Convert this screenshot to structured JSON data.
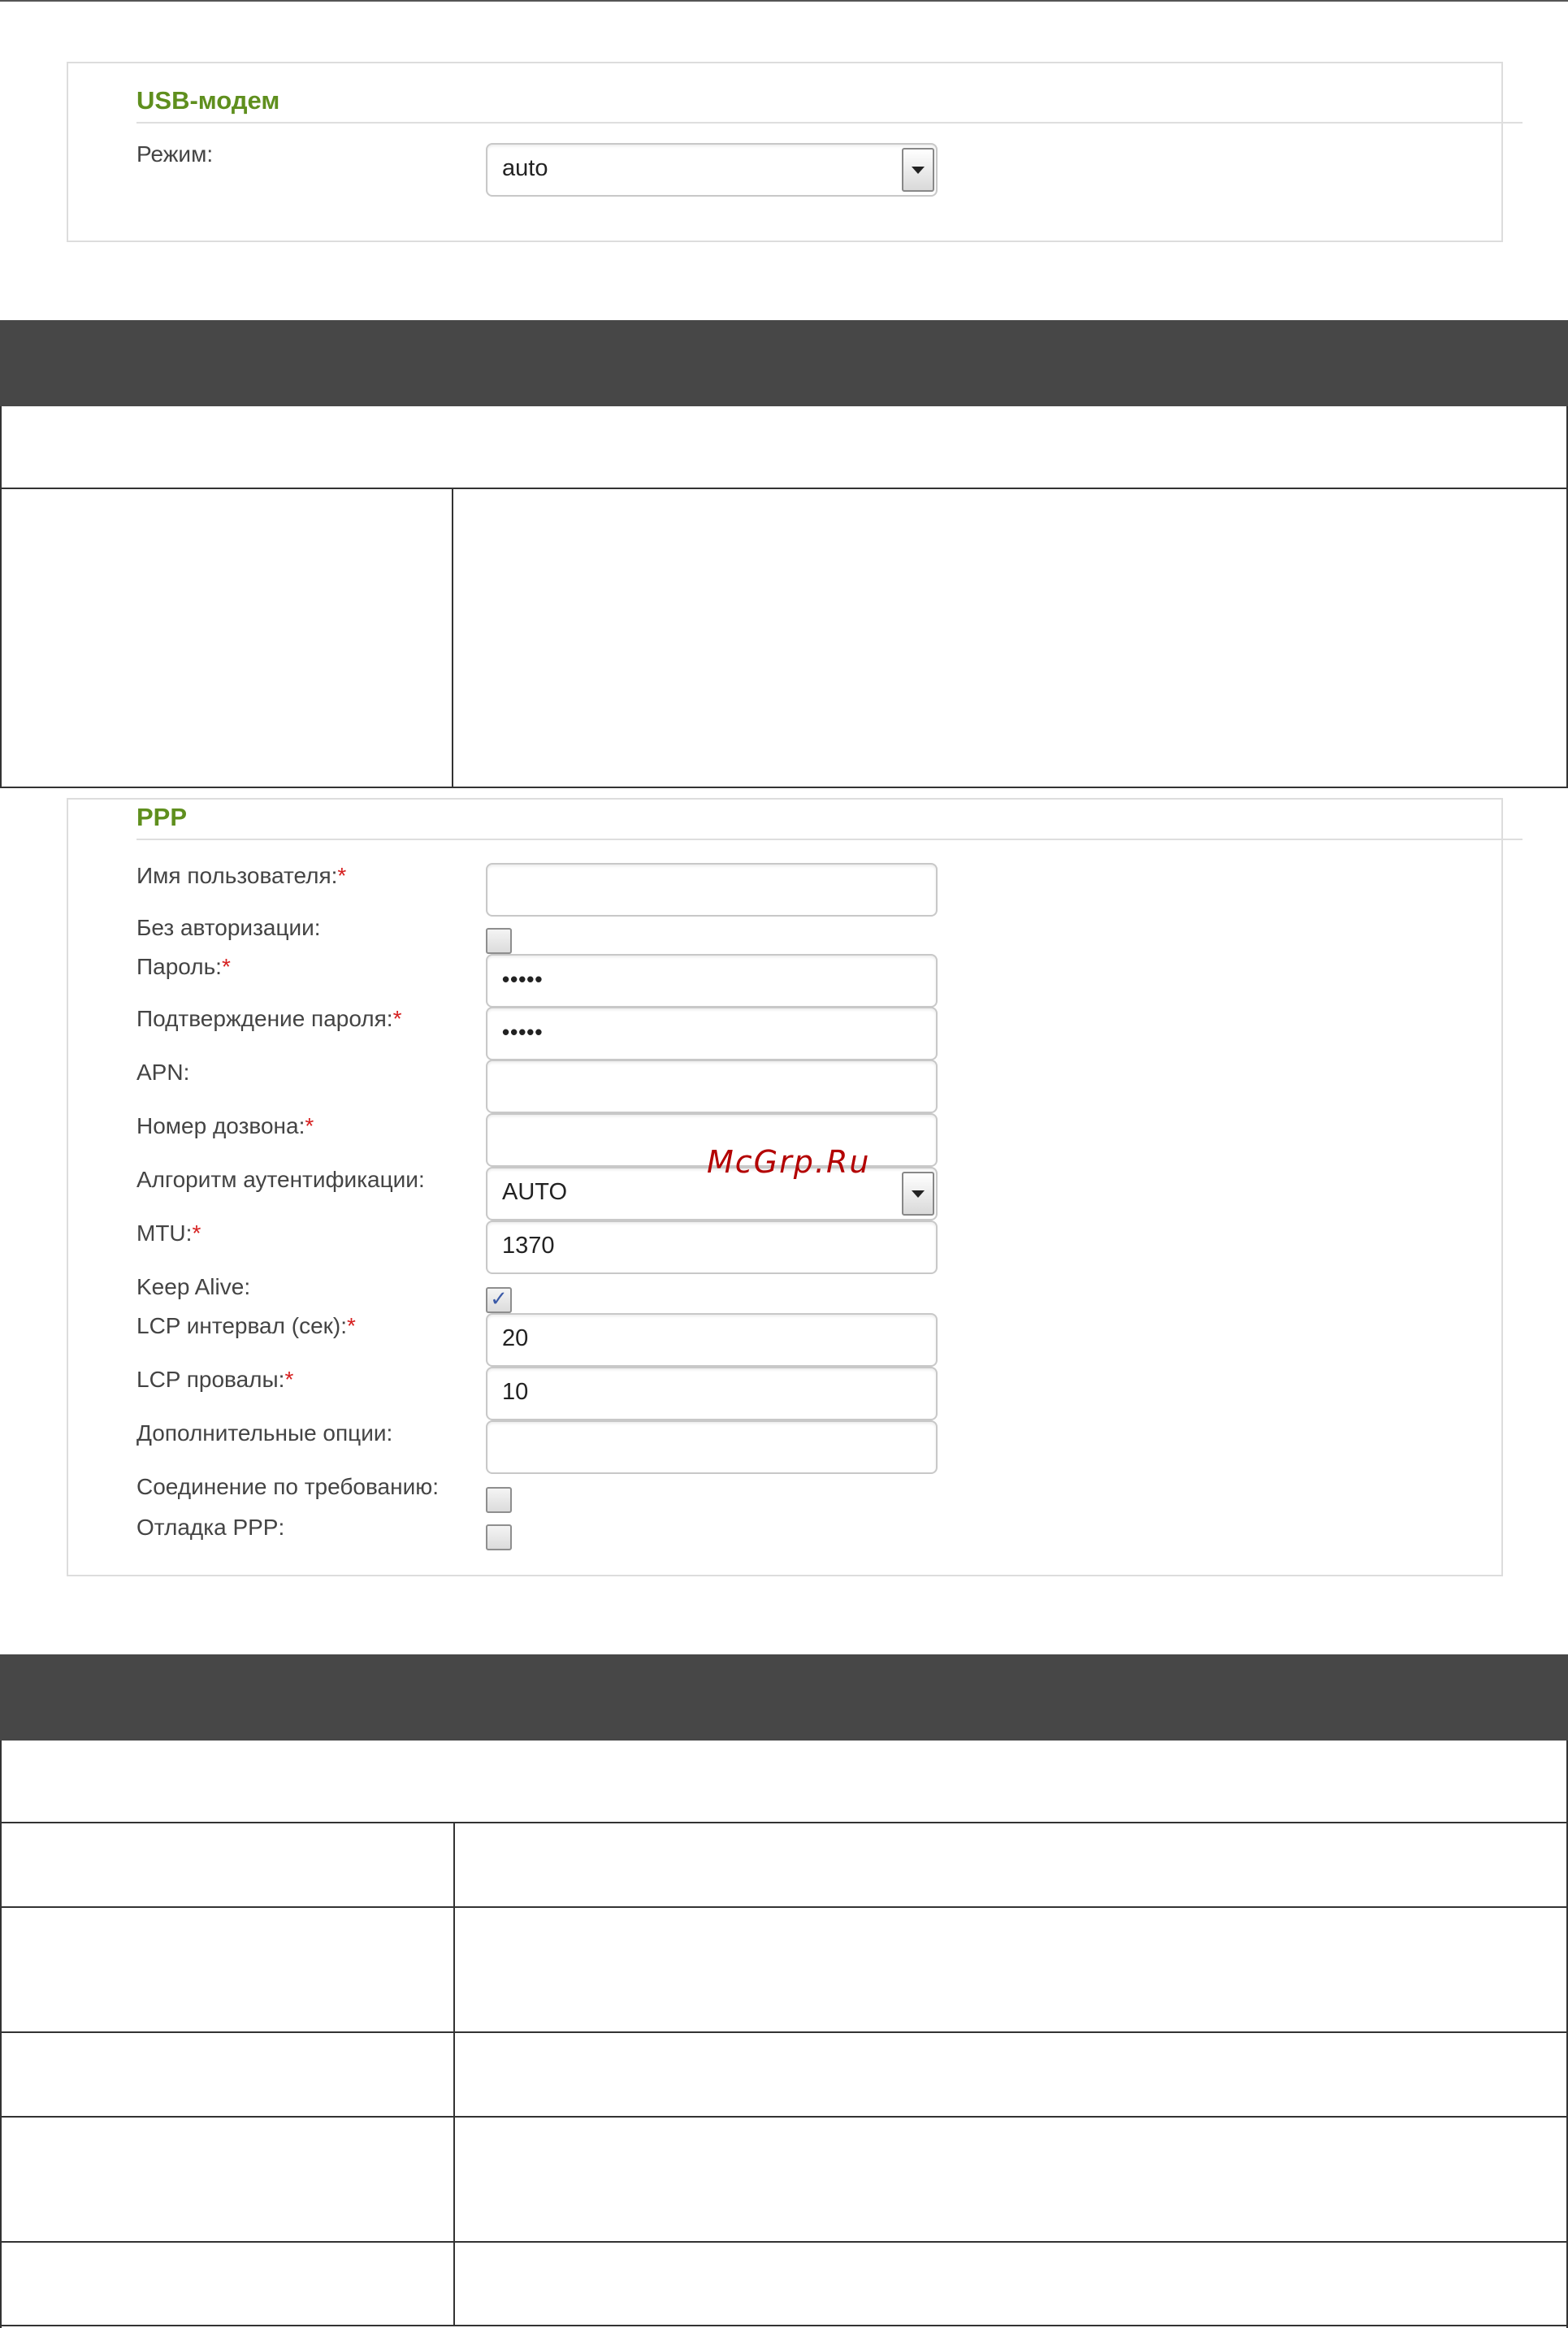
{
  "usb_panel": {
    "title": "USB-модем",
    "mode_label": "Режим:",
    "mode_value": "auto"
  },
  "ppp_panel": {
    "title": "PPP",
    "required_mark": "*",
    "fields": {
      "username": {
        "label": "Имя пользователя:",
        "value": ""
      },
      "no_auth": {
        "label": "Без авторизации:",
        "checked": false
      },
      "password": {
        "label": "Пароль:",
        "value": "•••••"
      },
      "password_confirm": {
        "label": "Подтверждение пароля:",
        "value": "•••••"
      },
      "apn": {
        "label": "APN:",
        "value": ""
      },
      "dial_number": {
        "label": "Номер дозвона:",
        "value": ""
      },
      "auth_algorithm": {
        "label": "Алгоритм аутентификации:",
        "value": "AUTO"
      },
      "mtu": {
        "label": "MTU:",
        "value": "1370"
      },
      "keep_alive": {
        "label": "Keep Alive:",
        "checked": true
      },
      "lcp_interval": {
        "label": "LCP интервал (сек):",
        "value": "20"
      },
      "lcp_failures": {
        "label": "LCP провалы:",
        "value": "10"
      },
      "extra_options": {
        "label": "Дополнительные опции:",
        "value": ""
      },
      "on_demand": {
        "label": "Соединение по требованию:",
        "checked": false
      },
      "ppp_debug": {
        "label": "Отладка PPP:",
        "checked": false
      }
    }
  },
  "watermark": "McGrp.Ru",
  "icons": {
    "dropdown": "chevron-down-icon",
    "check": "checkmark-icon"
  },
  "colors": {
    "section_title": "#5f8f1e",
    "required": "#d62020",
    "table_header": "#474747"
  }
}
